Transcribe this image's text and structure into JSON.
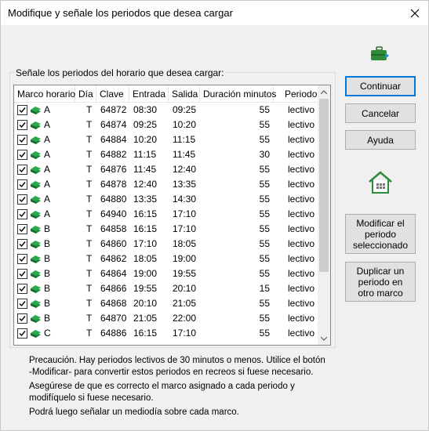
{
  "window": {
    "title": "Modifique y señale los periodos que desea cargar",
    "close_label": "✕"
  },
  "group": {
    "label": "Señale los periodos del horario que desea cargar:"
  },
  "columns": [
    "Marco horario",
    "Día",
    "Clave",
    "Entrada",
    "Salida",
    "Duración minutos",
    "Periodo"
  ],
  "rows": [
    {
      "marco": "A",
      "dia": "T",
      "clave": "64872",
      "entrada": "08:30",
      "salida": "09:25",
      "duracion": "55",
      "periodo": "lectivo"
    },
    {
      "marco": "A",
      "dia": "T",
      "clave": "64874",
      "entrada": "09:25",
      "salida": "10:20",
      "duracion": "55",
      "periodo": "lectivo"
    },
    {
      "marco": "A",
      "dia": "T",
      "clave": "64884",
      "entrada": "10:20",
      "salida": "11:15",
      "duracion": "55",
      "periodo": "lectivo"
    },
    {
      "marco": "A",
      "dia": "T",
      "clave": "64882",
      "entrada": "11:15",
      "salida": "11:45",
      "duracion": "30",
      "periodo": "lectivo"
    },
    {
      "marco": "A",
      "dia": "T",
      "clave": "64876",
      "entrada": "11:45",
      "salida": "12:40",
      "duracion": "55",
      "periodo": "lectivo"
    },
    {
      "marco": "A",
      "dia": "T",
      "clave": "64878",
      "entrada": "12:40",
      "salida": "13:35",
      "duracion": "55",
      "periodo": "lectivo"
    },
    {
      "marco": "A",
      "dia": "T",
      "clave": "64880",
      "entrada": "13:35",
      "salida": "14:30",
      "duracion": "55",
      "periodo": "lectivo"
    },
    {
      "marco": "A",
      "dia": "T",
      "clave": "64940",
      "entrada": "16:15",
      "salida": "17:10",
      "duracion": "55",
      "periodo": "lectivo"
    },
    {
      "marco": "B",
      "dia": "T",
      "clave": "64858",
      "entrada": "16:15",
      "salida": "17:10",
      "duracion": "55",
      "periodo": "lectivo"
    },
    {
      "marco": "B",
      "dia": "T",
      "clave": "64860",
      "entrada": "17:10",
      "salida": "18:05",
      "duracion": "55",
      "periodo": "lectivo"
    },
    {
      "marco": "B",
      "dia": "T",
      "clave": "64862",
      "entrada": "18:05",
      "salida": "19:00",
      "duracion": "55",
      "periodo": "lectivo"
    },
    {
      "marco": "B",
      "dia": "T",
      "clave": "64864",
      "entrada": "19:00",
      "salida": "19:55",
      "duracion": "55",
      "periodo": "lectivo"
    },
    {
      "marco": "B",
      "dia": "T",
      "clave": "64866",
      "entrada": "19:55",
      "salida": "20:10",
      "duracion": "15",
      "periodo": "lectivo"
    },
    {
      "marco": "B",
      "dia": "T",
      "clave": "64868",
      "entrada": "20:10",
      "salida": "21:05",
      "duracion": "55",
      "periodo": "lectivo"
    },
    {
      "marco": "B",
      "dia": "T",
      "clave": "64870",
      "entrada": "21:05",
      "salida": "22:00",
      "duracion": "55",
      "periodo": "lectivo"
    },
    {
      "marco": "C",
      "dia": "T",
      "clave": "64886",
      "entrada": "16:15",
      "salida": "17:10",
      "duracion": "55",
      "periodo": "lectivo"
    }
  ],
  "buttons": {
    "continuar": "Continuar",
    "cancelar": "Cancelar",
    "ayuda": "Ayuda",
    "modificar": "Modificar el periodo seleccionado",
    "duplicar": "Duplicar un periodo en otro marco"
  },
  "notes": {
    "line1": "Precaución. Hay periodos lectivos de 30 minutos o menos. Utilice el botón -Modificar- para convertir estos periodos en recreos si fuese necesario.",
    "line2": "Asegúrese de que es correcto el marco asignado a cada periodo y modifíquelo si fuese necesario.",
    "line3": "Podrá luego señalar un mediodía sobre cada marco."
  },
  "icons": {
    "suitcase": "suitcase-icon",
    "house": "house-icon",
    "book": "book-icon",
    "checkbox": "checkbox-icon"
  },
  "colors": {
    "accent": "#0078d7",
    "book": "#1e8a3c",
    "icon_green": "#2e8b3a"
  }
}
